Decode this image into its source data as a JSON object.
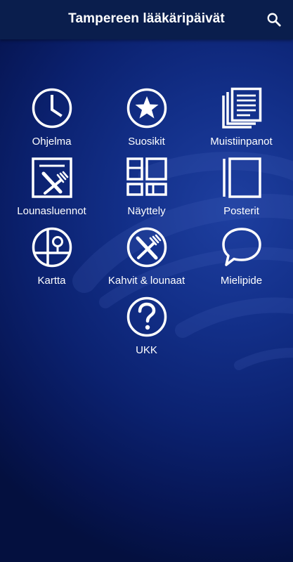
{
  "header": {
    "title": "Tampereen lääkäripäivät",
    "search_icon": "search-icon"
  },
  "menu": {
    "items": [
      {
        "label": "Ohjelma",
        "icon": "clock-icon"
      },
      {
        "label": "Suosikit",
        "icon": "star-icon"
      },
      {
        "label": "Muistiinpanot",
        "icon": "notes-icon"
      },
      {
        "label": "Lounasluennot",
        "icon": "lunch-lecture-icon"
      },
      {
        "label": "Näyttely",
        "icon": "exhibition-icon"
      },
      {
        "label": "Posterit",
        "icon": "posters-icon"
      },
      {
        "label": "Kartta",
        "icon": "map-icon"
      },
      {
        "label": "Kahvit & lounaat",
        "icon": "cutlery-icon"
      },
      {
        "label": "Mielipide",
        "icon": "speech-bubble-icon"
      },
      {
        "label": "UKK",
        "icon": "question-icon"
      }
    ]
  },
  "colors": {
    "header_bg": "#0a1e4d",
    "background": "#0b216f",
    "icon": "#ffffff"
  }
}
